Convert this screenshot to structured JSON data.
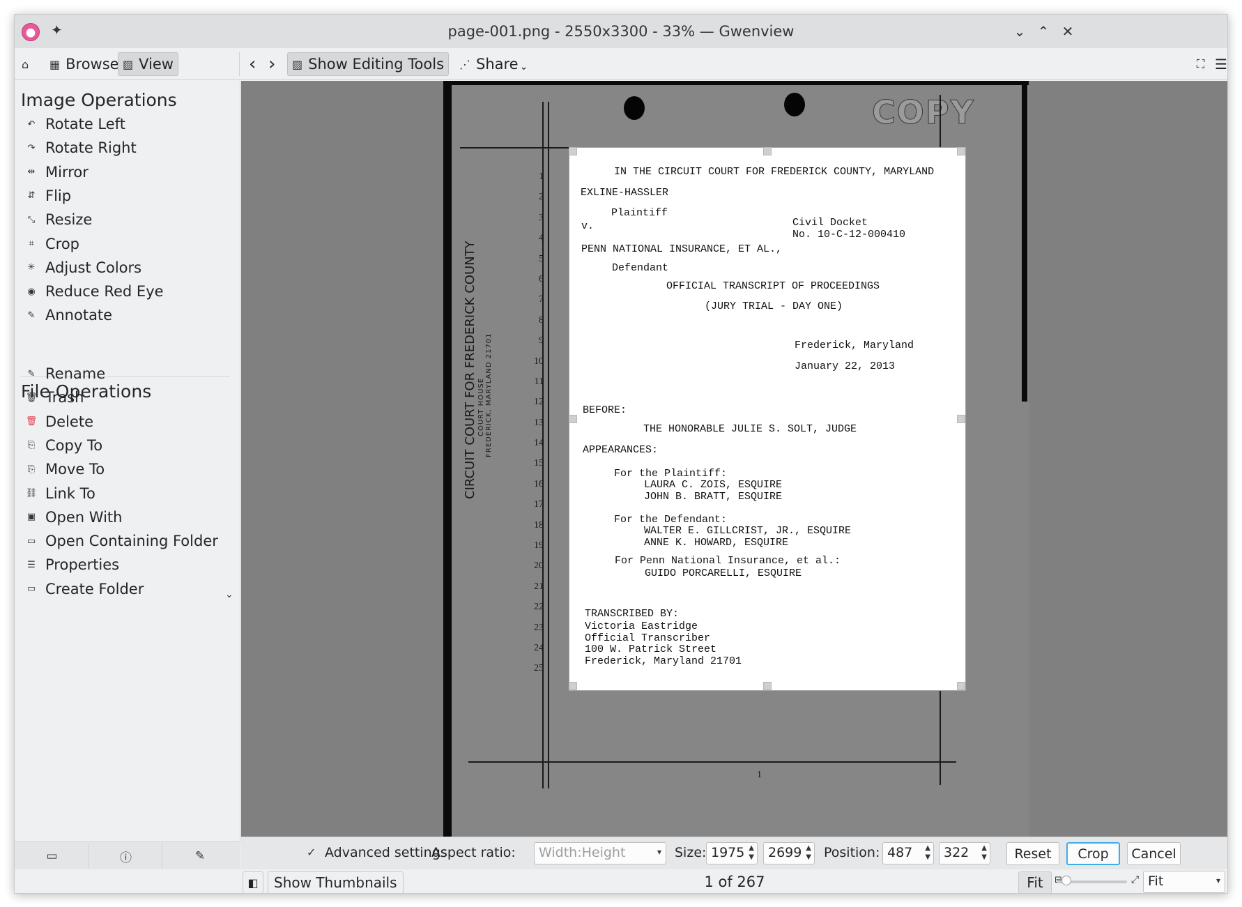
{
  "window": {
    "title": "page-001.png - 2550x3300 - 33% — Gwenview",
    "pin_icon": "pin-icon",
    "buttons": [
      "chevron-down-icon",
      "chevron-up-icon",
      "close-icon"
    ]
  },
  "toolbar": {
    "home_icon": "⌂",
    "browse": "Browse",
    "view": "View",
    "prev": "‹",
    "next": "›",
    "show_editing_tools": "Show Editing Tools",
    "share": "Share",
    "share_chevron": "⌄"
  },
  "sidebar": {
    "image_ops_title": "Image Operations",
    "image_ops": [
      {
        "label": "Rotate Left",
        "icon": "rotate-left-icon",
        "glyph": "↶"
      },
      {
        "label": "Rotate Right",
        "icon": "rotate-right-icon",
        "glyph": "↷"
      },
      {
        "label": "Mirror",
        "icon": "mirror-icon",
        "glyph": "⇹"
      },
      {
        "label": "Flip",
        "icon": "flip-icon",
        "glyph": "⇵"
      },
      {
        "label": "Resize",
        "icon": "resize-icon",
        "glyph": "⤡"
      },
      {
        "label": "Crop",
        "icon": "crop-icon",
        "glyph": "⌗"
      },
      {
        "label": "Adjust Colors",
        "icon": "adjust-colors-icon",
        "glyph": "✳"
      },
      {
        "label": "Reduce Red Eye",
        "icon": "red-eye-icon",
        "glyph": "◉"
      },
      {
        "label": "Annotate",
        "icon": "annotate-icon",
        "glyph": "✎"
      }
    ],
    "file_ops_title": "File Operations",
    "file_ops": [
      {
        "label": "Rename",
        "icon": "rename-icon",
        "glyph": "✎"
      },
      {
        "label": "Trash",
        "icon": "trash-icon",
        "glyph": "🗑"
      },
      {
        "label": "Delete",
        "icon": "delete-icon",
        "glyph": "🗑"
      },
      {
        "label": "Copy To",
        "icon": "copy-to-icon",
        "glyph": "⎘"
      },
      {
        "label": "Move To",
        "icon": "move-to-icon",
        "glyph": "⎘"
      },
      {
        "label": "Link To",
        "icon": "link-to-icon",
        "glyph": "⛓"
      },
      {
        "label": "Open With",
        "icon": "open-with-icon",
        "glyph": "▣"
      },
      {
        "label": "Open Containing Folder",
        "icon": "folder-icon",
        "glyph": "▭"
      },
      {
        "label": "Properties",
        "icon": "properties-icon",
        "glyph": "☰"
      },
      {
        "label": "Create Folder",
        "icon": "create-folder-icon",
        "glyph": "▭"
      }
    ],
    "more_chevron": "⌄",
    "bottom_icons": {
      "folder": "▭",
      "info": "ⓘ",
      "edit": "✎"
    }
  },
  "document": {
    "copy_stamp": "COPY",
    "side_title": "CIRCUIT COURT FOR FREDERICK COUNTY",
    "side_sub1": "COURT HOUSE",
    "side_sub2": "FREDERICK, MARYLAND 21701",
    "line_numbers": [
      "1",
      "2",
      "3",
      "4",
      "5",
      "6",
      "7",
      "8",
      "9",
      "10",
      "11",
      "12",
      "13",
      "14",
      "15",
      "16",
      "17",
      "18",
      "19",
      "20",
      "21",
      "22",
      "23",
      "24",
      "25"
    ],
    "page_number": "1",
    "lines": {
      "court": "IN THE CIRCUIT COURT FOR FREDERICK COUNTY, MARYLAND",
      "plaintiff_name": "EXLINE-HASSLER",
      "plaintiff": "Plaintiff",
      "v": "v.",
      "civil_docket": "Civil Docket",
      "docket_no": "No. 10-C-12-000410",
      "defendant_name": "PENN NATIONAL INSURANCE, ET AL.,",
      "defendant": "Defendant",
      "official": "OFFICIAL TRANSCRIPT OF PROCEEDINGS",
      "jury": "(JURY TRIAL - DAY ONE)",
      "place": "Frederick, Maryland",
      "date": "January 22, 2013",
      "before": "BEFORE:",
      "judge": "THE HONORABLE JULIE S. SOLT, JUDGE",
      "appearances": "APPEARANCES:",
      "for_plaintiff": "For the Plaintiff:",
      "p_att1": "LAURA C. ZOIS, ESQUIRE",
      "p_att2": "JOHN B. BRATT, ESQUIRE",
      "for_defendant": "For the Defendant:",
      "d_att1": "WALTER E. GILLCRIST, JR., ESQUIRE",
      "d_att2": "ANNE K. HOWARD, ESQUIRE",
      "for_penn": "For Penn National Insurance, et al.:",
      "penn_att": "GUIDO PORCARELLI, ESQUIRE",
      "transcribed": "TRANSCRIBED BY:",
      "t_name": "Victoria Eastridge",
      "t_title": "Official Transcriber",
      "t_street": "100 W. Patrick Street",
      "t_city": "Frederick, Maryland  21701"
    }
  },
  "cropbar": {
    "advanced_checked": "✓",
    "advanced_label": "Advanced settings",
    "aspect_label": "Aspect ratio:",
    "aspect_placeholder": "Width:Height",
    "size_label": "Size:",
    "width": "1975",
    "height": "2699",
    "position_label": "Position:",
    "pos_x": "487",
    "pos_y": "322",
    "reset": "Reset",
    "crop": "Crop",
    "cancel": "Cancel"
  },
  "statusbar": {
    "sidebar_toggle": "◧",
    "show_thumbnails": "Show Thumbnails",
    "counter": "1 of 267",
    "fit_button": "Fit",
    "zoom_select": "Fit",
    "zoom_out_icon": "⊟",
    "zoom_in_icon": "⤢"
  },
  "colors": {
    "accent": "#3daee9",
    "canvas_bg": "#808080",
    "delete_red": "#da4453"
  }
}
